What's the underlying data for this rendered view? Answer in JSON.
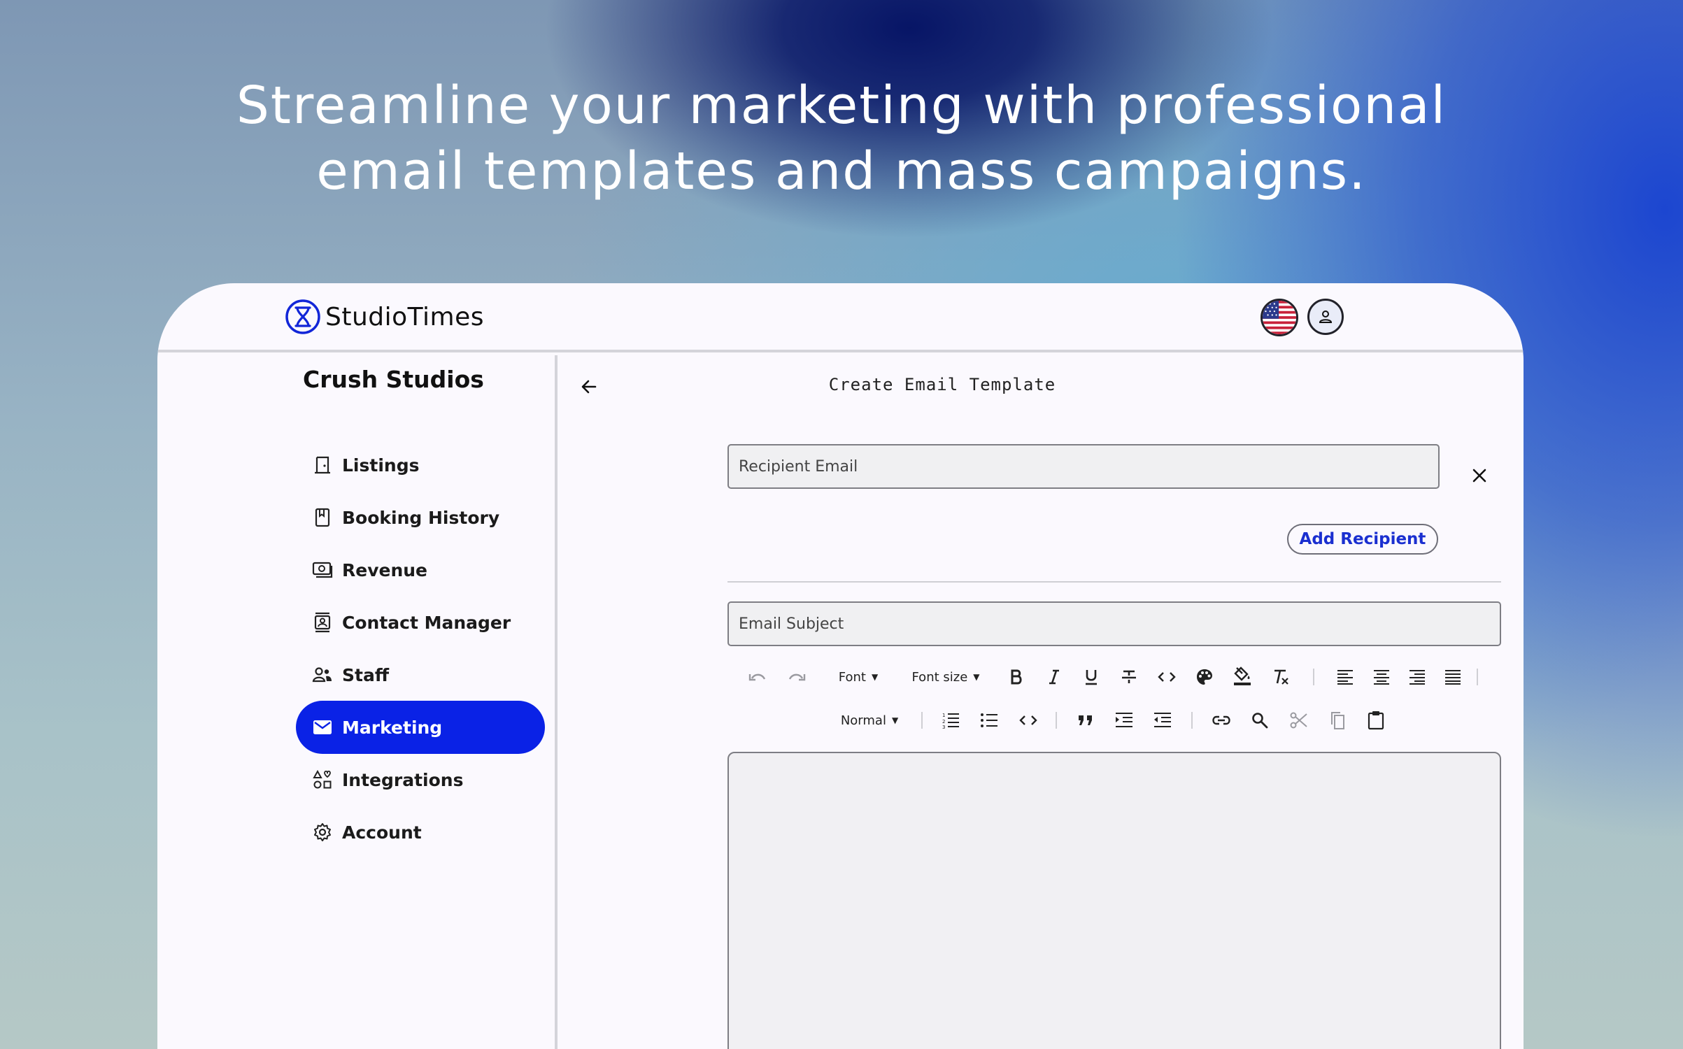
{
  "headline": {
    "line1": "Streamline your marketing with professional",
    "line2": "email templates and mass campaigns."
  },
  "header": {
    "brand": "StudioTimes",
    "logo_icon": "hourglass-icon",
    "language_icon": "us-flag-icon",
    "account_icon": "user-icon"
  },
  "sidebar": {
    "studio_name": "Crush Studios",
    "items": [
      {
        "label": "Listings",
        "icon": "door-icon"
      },
      {
        "label": "Booking History",
        "icon": "book-icon"
      },
      {
        "label": "Revenue",
        "icon": "cash-icon"
      },
      {
        "label": "Contact Manager",
        "icon": "contacts-icon"
      },
      {
        "label": "Staff",
        "icon": "people-icon"
      },
      {
        "label": "Marketing",
        "icon": "mail-icon",
        "active": true
      },
      {
        "label": "Integrations",
        "icon": "shapes-icon"
      },
      {
        "label": "Account",
        "icon": "gear-icon"
      }
    ]
  },
  "main": {
    "title": "Create Email Template",
    "recipient_placeholder": "Recipient Email",
    "add_recipient_label": "Add Recipient",
    "subject_placeholder": "Email Subject",
    "toolbar": {
      "font_label": "Font",
      "font_size_label": "Font size",
      "block_label": "Normal"
    }
  },
  "colors": {
    "accent": "#0a22e6",
    "link": "#1a2fd0",
    "text": "#1b1b1b"
  }
}
